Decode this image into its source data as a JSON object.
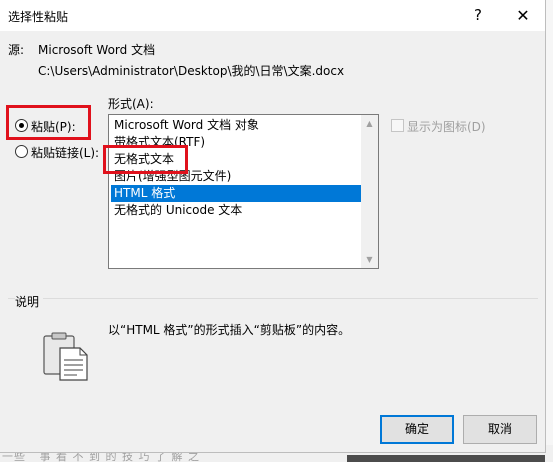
{
  "dialog": {
    "title": "选择性粘贴",
    "help_icon": "?",
    "close_icon": "✕",
    "source_label": "源:",
    "source_app": "Microsoft Word 文档",
    "source_path": "C:\\Users\\Administrator\\Desktop\\我的\\日常\\文案.docx",
    "format_label": "形式(A):",
    "paste_label": "粘贴(P):",
    "paste_link_label": "粘贴链接(L):",
    "display_as_icon_label": "显示为图标(D)",
    "formats": [
      {
        "label": "Microsoft Word 文档 对象",
        "selected": false
      },
      {
        "label": "带格式文本(RTF)",
        "selected": false
      },
      {
        "label": "无格式文本",
        "selected": false
      },
      {
        "label": "图片(增强型图元文件)",
        "selected": false
      },
      {
        "label": "HTML 格式",
        "selected": true
      },
      {
        "label": "无格式的 Unicode 文本",
        "selected": false
      }
    ],
    "description_label": "说明",
    "description_text": "以“HTML 格式”的形式插入“剪贴板”的内容。",
    "ok_label": "确定",
    "cancel_label": "取消",
    "selected_radio": "paste"
  },
  "background": {
    "bottom_text": "一些   事 看 不 到 的 技 巧 了 解 之"
  },
  "colors": {
    "highlight_red": "#e0111c",
    "selection_blue": "#0078d7"
  }
}
